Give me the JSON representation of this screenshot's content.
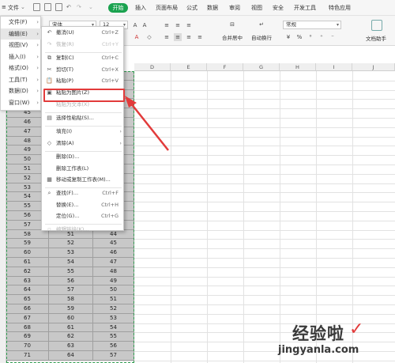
{
  "menubar": {
    "items": [
      "文件",
      "开始",
      "插入",
      "页面布局",
      "公式",
      "数据",
      "审阅",
      "视图",
      "安全",
      "开发工具",
      "特色应用"
    ],
    "start_color": "#1aa24f"
  },
  "ribbon": {
    "font_name": "宋体",
    "font_size": "12",
    "number_format": "常规",
    "merge_label": "合并居中",
    "wrap_label": "自动换行",
    "assistant_label": "文档助手"
  },
  "left_menu": {
    "items": [
      {
        "label": "文件(F)",
        "chev": "›"
      },
      {
        "label": "编辑(E)",
        "chev": "›"
      },
      {
        "label": "视图(V)",
        "chev": "›"
      },
      {
        "label": "插入(I)",
        "chev": "›"
      },
      {
        "label": "格式(O)",
        "chev": "›"
      },
      {
        "label": "工具(T)",
        "chev": "›"
      },
      {
        "label": "数据(D)",
        "chev": "›"
      },
      {
        "label": "窗口(W)",
        "chev": "›"
      }
    ]
  },
  "context_menu": {
    "items": [
      {
        "icon": "↶",
        "icon_name": "undo-icon",
        "label": "撤消(U)",
        "shortcut": "Ctrl+Z",
        "disabled": false
      },
      {
        "icon": "↷",
        "icon_name": "redo-icon",
        "label": "恢复(R)",
        "shortcut": "Ctrl+Y",
        "disabled": true
      },
      {
        "icon": "⧉",
        "icon_name": "copy-icon",
        "label": "复制(C)",
        "shortcut": "Ctrl+C",
        "disabled": false
      },
      {
        "icon": "✂",
        "icon_name": "cut-icon",
        "label": "剪切(T)",
        "shortcut": "Ctrl+X",
        "disabled": false
      },
      {
        "icon": "📋",
        "icon_name": "paste-icon",
        "label": "粘贴(P)",
        "shortcut": "Ctrl+V",
        "disabled": false
      },
      {
        "icon": "▣",
        "icon_name": "paste-as-picture-icon",
        "label": "粘贴为图片(Z)",
        "shortcut": "",
        "disabled": false
      },
      {
        "icon": "",
        "icon_name": "paste-text-icon",
        "label": "粘贴为文本(X)",
        "shortcut": "",
        "disabled": true
      },
      {
        "icon": "▤",
        "icon_name": "paste-special-icon",
        "label": "选择性粘贴(S)...",
        "shortcut": "",
        "disabled": false
      },
      {
        "icon": "",
        "icon_name": "fill-icon",
        "label": "填充(I)",
        "shortcut": "",
        "submenu": true,
        "disabled": false
      },
      {
        "icon": "◇",
        "icon_name": "clear-icon",
        "label": "清除(A)",
        "shortcut": "",
        "submenu": true,
        "disabled": false
      },
      {
        "icon": "",
        "icon_name": "delete-icon",
        "label": "删除(D)...",
        "shortcut": "",
        "disabled": false
      },
      {
        "icon": "",
        "icon_name": "delete-sheet-icon",
        "label": "删除工作表(L)",
        "shortcut": "",
        "disabled": false
      },
      {
        "icon": "▦",
        "icon_name": "move-copy-sheet-icon",
        "label": "移动或复制工作表(M)...",
        "shortcut": "",
        "disabled": false
      },
      {
        "icon": "⌕",
        "icon_name": "find-icon",
        "label": "查找(F)...",
        "shortcut": "Ctrl+F",
        "disabled": false
      },
      {
        "icon": "",
        "icon_name": "replace-icon",
        "label": "替换(E)...",
        "shortcut": "Ctrl+H",
        "disabled": false
      },
      {
        "icon": "",
        "icon_name": "goto-icon",
        "label": "定位(G)...",
        "shortcut": "Ctrl+G",
        "disabled": false
      },
      {
        "icon": "▫",
        "icon_name": "edit-link-icon",
        "label": "编辑链接(K)...",
        "shortcut": "",
        "disabled": true
      }
    ]
  },
  "columns": [
    "D",
    "E",
    "F",
    "G",
    "H",
    "I",
    "J"
  ],
  "rows": [
    [
      "41",
      "",
      ""
    ],
    [
      "42",
      "",
      ""
    ],
    [
      "43",
      "",
      ""
    ],
    [
      "44",
      "",
      ""
    ],
    [
      "45",
      "",
      ""
    ],
    [
      "46",
      "",
      ""
    ],
    [
      "47",
      "",
      ""
    ],
    [
      "48",
      "",
      ""
    ],
    [
      "49",
      "",
      ""
    ],
    [
      "50",
      "",
      ""
    ],
    [
      "51",
      "",
      ""
    ],
    [
      "52",
      "",
      ""
    ],
    [
      "53",
      "",
      ""
    ],
    [
      "54",
      "",
      ""
    ],
    [
      "55",
      "",
      ""
    ],
    [
      "56",
      "49",
      "42"
    ],
    [
      "57",
      "50",
      "43"
    ],
    [
      "58",
      "51",
      "44"
    ],
    [
      "59",
      "52",
      "45"
    ],
    [
      "60",
      "53",
      "46"
    ],
    [
      "61",
      "54",
      "47"
    ],
    [
      "62",
      "55",
      "48"
    ],
    [
      "63",
      "56",
      "49"
    ],
    [
      "64",
      "57",
      "50"
    ],
    [
      "65",
      "58",
      "51"
    ],
    [
      "66",
      "59",
      "52"
    ],
    [
      "67",
      "60",
      "53"
    ],
    [
      "68",
      "61",
      "54"
    ],
    [
      "69",
      "62",
      "55"
    ],
    [
      "70",
      "63",
      "56"
    ],
    [
      "71",
      "64",
      "57"
    ]
  ],
  "watermark": {
    "cn": "经验啦",
    "check": "✓",
    "url": "jingyanla.com"
  },
  "colors": {
    "highlight": "#e23b3b",
    "selection": "#2e9b4e",
    "cell_fill": "#c8c8c8"
  }
}
